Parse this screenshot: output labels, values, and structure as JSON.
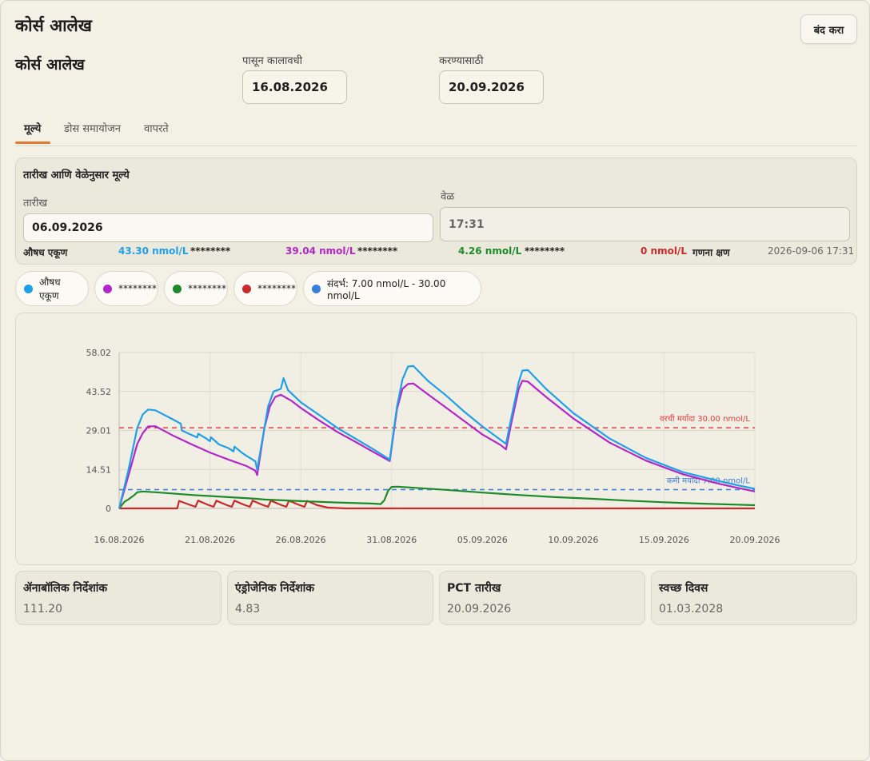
{
  "window": {
    "title": "कोर्स आलेख",
    "close_label": "बंद करा"
  },
  "header": {
    "section_title": "कोर्स आलेख",
    "from_label": "पासून कालावधी",
    "from_value": "16.08.2026",
    "to_label": "करण्यासाठी",
    "to_value": "20.09.2026"
  },
  "tabs": [
    {
      "label": "मूल्ये",
      "active": true
    },
    {
      "label": "डोस समायोजन",
      "active": false
    },
    {
      "label": "वापरते",
      "active": false
    }
  ],
  "values_panel": {
    "title": "तारीख आणि वेळेनुसार मूल्ये",
    "date_label": "तारीख",
    "date_value": "06.09.2026",
    "time_label": "वेळ",
    "time_value": "17:31",
    "readouts": [
      {
        "name": "औषध एकूण",
        "value": "43.30 nmol/L",
        "color": "#1fa0e8"
      },
      {
        "name": "********",
        "value": "39.04 nmol/L",
        "color": "#b327c9"
      },
      {
        "name": "********",
        "value": "4.26 nmol/L",
        "color": "#1d8a2a"
      },
      {
        "name": "********",
        "value": "0 nmol/L",
        "color": "#c92a2a"
      }
    ],
    "calc_label": "गणना क्षण",
    "calc_value": "2026-09-06 17:31"
  },
  "legend": [
    {
      "label": "औषध एकूण",
      "color": "#1fa0e8"
    },
    {
      "label": "********",
      "color": "#b327c9"
    },
    {
      "label": "********",
      "color": "#1d8a2a"
    },
    {
      "label": "********",
      "color": "#c92a2a"
    },
    {
      "label": "संदर्भ: 7.00 nmol/L - 30.00 nmol/L",
      "color": "#3b7ddd"
    }
  ],
  "chart_data": {
    "type": "line",
    "x_ticks": [
      "16.08.2026",
      "21.08.2026",
      "26.08.2026",
      "31.08.2026",
      "05.09.2026",
      "10.09.2026",
      "15.09.2026",
      "20.09.2026"
    ],
    "y_ticks": [
      "0",
      "14.51",
      "29.01",
      "43.52",
      "58.02"
    ],
    "xlim": [
      "16.08.2026",
      "20.09.2026"
    ],
    "ylim": [
      0,
      58.02
    ],
    "upper_limit": {
      "value": 30.0,
      "label": "वरची मर्यादा 30.00 nmol/L",
      "color": "#e04040"
    },
    "lower_limit": {
      "value": 7.0,
      "label": "कमी मर्यादा 7.00 nmol/L",
      "color": "#3b7ddd"
    },
    "series": [
      {
        "name": "औषध एकूण",
        "color": "#1fa0e8",
        "points": [
          [
            0,
            0
          ],
          [
            0.5,
            14
          ],
          [
            1,
            30
          ],
          [
            1.3,
            35
          ],
          [
            1.6,
            36.8
          ],
          [
            2,
            36.5
          ],
          [
            3,
            33
          ],
          [
            3.4,
            31.5
          ],
          [
            3.45,
            29
          ],
          [
            3.9,
            27.6
          ],
          [
            4.3,
            26.4
          ],
          [
            4.35,
            27.8
          ],
          [
            4.8,
            26
          ],
          [
            5,
            25
          ],
          [
            5.05,
            26.5
          ],
          [
            5.5,
            23.8
          ],
          [
            6,
            22.5
          ],
          [
            6.3,
            21.2
          ],
          [
            6.35,
            23
          ],
          [
            6.8,
            20.5
          ],
          [
            7,
            19.6
          ],
          [
            7.2,
            18.8
          ],
          [
            7.5,
            17.5
          ],
          [
            7.6,
            14.4
          ],
          [
            8,
            30
          ],
          [
            8.2,
            38
          ],
          [
            8.5,
            43.5
          ],
          [
            8.9,
            44.5
          ],
          [
            9.05,
            48.5
          ],
          [
            9.3,
            44
          ],
          [
            10,
            39.5
          ],
          [
            11,
            34.8
          ],
          [
            12,
            30
          ],
          [
            13,
            26
          ],
          [
            14,
            22
          ],
          [
            14.8,
            18.6
          ],
          [
            14.9,
            18
          ],
          [
            15.3,
            38
          ],
          [
            15.6,
            48
          ],
          [
            15.9,
            52.8
          ],
          [
            16.2,
            53
          ],
          [
            17,
            47.5
          ],
          [
            18,
            42
          ],
          [
            19,
            36
          ],
          [
            20,
            30.5
          ],
          [
            21,
            25.5
          ],
          [
            21.3,
            24
          ],
          [
            21.6,
            34
          ],
          [
            22,
            47
          ],
          [
            22.2,
            51.3
          ],
          [
            22.5,
            51.5
          ],
          [
            23.5,
            44.5
          ],
          [
            25,
            35.5
          ],
          [
            27,
            26
          ],
          [
            29,
            18.8
          ],
          [
            31,
            13.6
          ],
          [
            33,
            10.2
          ],
          [
            34,
            8.7
          ],
          [
            35,
            7.3
          ]
        ]
      },
      {
        "name": "********",
        "color": "#b327c9",
        "points": [
          [
            0,
            0
          ],
          [
            0.5,
            12
          ],
          [
            1,
            24
          ],
          [
            1.3,
            28
          ],
          [
            1.6,
            30.5
          ],
          [
            2,
            30.6
          ],
          [
            3,
            27
          ],
          [
            4,
            23.8
          ],
          [
            5,
            20.8
          ],
          [
            6,
            18.2
          ],
          [
            7,
            15.8
          ],
          [
            7.5,
            14
          ],
          [
            7.6,
            12.4
          ],
          [
            8,
            30
          ],
          [
            8.3,
            38
          ],
          [
            8.6,
            41.5
          ],
          [
            8.9,
            42.3
          ],
          [
            9.5,
            40
          ],
          [
            10,
            37.4
          ],
          [
            11,
            32.8
          ],
          [
            12,
            28.5
          ],
          [
            13,
            24.8
          ],
          [
            14,
            21
          ],
          [
            14.8,
            18
          ],
          [
            14.9,
            17.6
          ],
          [
            15.3,
            37
          ],
          [
            15.6,
            44.5
          ],
          [
            15.9,
            46.3
          ],
          [
            16.2,
            46.5
          ],
          [
            17,
            42.5
          ],
          [
            18,
            37.5
          ],
          [
            19,
            32.5
          ],
          [
            20,
            27.5
          ],
          [
            21,
            23.6
          ],
          [
            21.3,
            22
          ],
          [
            21.6,
            32
          ],
          [
            22,
            44.5
          ],
          [
            22.2,
            47.5
          ],
          [
            22.5,
            47.2
          ],
          [
            23.5,
            41.5
          ],
          [
            25,
            33.5
          ],
          [
            27,
            24.5
          ],
          [
            29,
            17.8
          ],
          [
            31,
            12.8
          ],
          [
            33,
            9.2
          ],
          [
            34,
            7.7
          ],
          [
            35,
            6.3
          ]
        ]
      },
      {
        "name": "********",
        "color": "#1d8a2a",
        "points": [
          [
            0,
            0
          ],
          [
            0.3,
            2.5
          ],
          [
            0.5,
            3.3
          ],
          [
            0.8,
            4.8
          ],
          [
            1,
            6
          ],
          [
            1.3,
            6.3
          ],
          [
            2,
            6
          ],
          [
            4,
            5
          ],
          [
            6,
            4.2
          ],
          [
            7.5,
            3.6
          ],
          [
            8,
            3.3
          ],
          [
            10,
            2.7
          ],
          [
            12,
            2.2
          ],
          [
            14,
            1.8
          ],
          [
            14.4,
            1.6
          ],
          [
            14.6,
            3
          ],
          [
            14.8,
            6.5
          ],
          [
            15,
            8
          ],
          [
            15.3,
            8.1
          ],
          [
            16,
            7.8
          ],
          [
            18,
            6.9
          ],
          [
            20,
            5.9
          ],
          [
            22,
            5
          ],
          [
            24,
            4.2
          ],
          [
            26,
            3.6
          ],
          [
            28,
            2.9
          ],
          [
            30,
            2.3
          ],
          [
            32,
            1.8
          ],
          [
            34,
            1.4
          ],
          [
            35,
            1.2
          ]
        ]
      },
      {
        "name": "********",
        "color": "#c92a2a",
        "points": [
          [
            0,
            0
          ],
          [
            3.2,
            0
          ],
          [
            3.3,
            2.8
          ],
          [
            3.9,
            1.3
          ],
          [
            4.2,
            0.6
          ],
          [
            4.35,
            2.9
          ],
          [
            4.9,
            1.3
          ],
          [
            5.2,
            0.6
          ],
          [
            5.35,
            2.9
          ],
          [
            5.9,
            1.3
          ],
          [
            6.2,
            0.6
          ],
          [
            6.35,
            2.9
          ],
          [
            6.9,
            1.3
          ],
          [
            7.2,
            0.6
          ],
          [
            7.35,
            2.9
          ],
          [
            7.9,
            1.3
          ],
          [
            8.2,
            0.6
          ],
          [
            8.35,
            2.9
          ],
          [
            8.9,
            1.3
          ],
          [
            9.2,
            0.6
          ],
          [
            9.35,
            2.9
          ],
          [
            9.9,
            1.3
          ],
          [
            10.2,
            0.6
          ],
          [
            10.35,
            2.8
          ],
          [
            10.9,
            1.2
          ],
          [
            11.5,
            0.3
          ],
          [
            12.5,
            0
          ],
          [
            35,
            0
          ]
        ]
      }
    ]
  },
  "cards": [
    {
      "title": "ॲनाबॉलिक निर्देशांक",
      "value": "111.20"
    },
    {
      "title": "एंड्रोजेनिक निर्देशांक",
      "value": "4.83"
    },
    {
      "title": "PCT तारीख",
      "value": "20.09.2026"
    },
    {
      "title": "स्वच्छ दिवस",
      "value": "01.03.2028"
    }
  ]
}
